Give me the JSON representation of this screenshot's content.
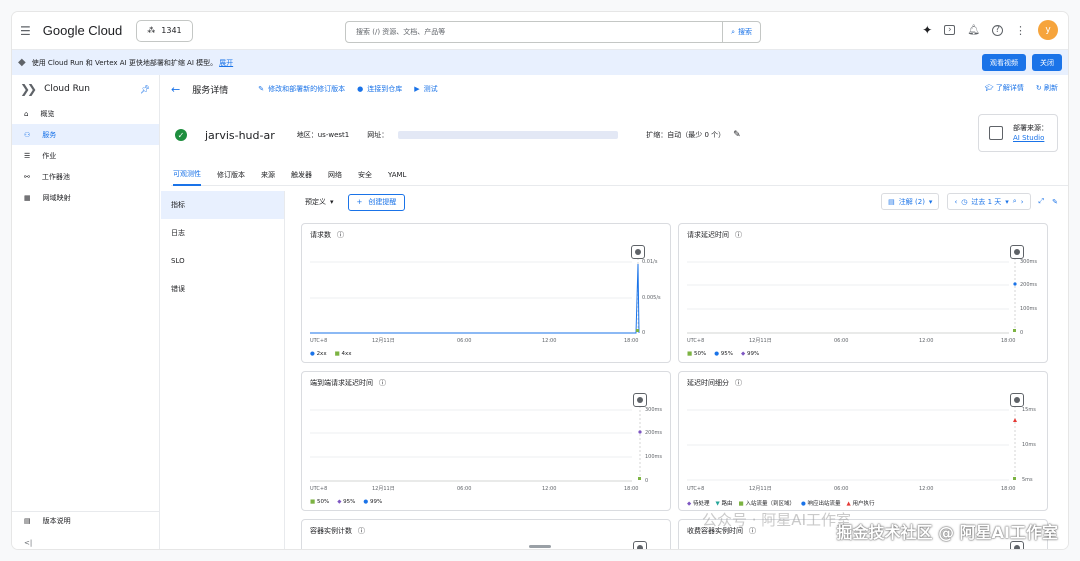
{
  "topbar": {
    "logo": "Google Cloud",
    "project": "1341",
    "search_placeholder": "搜索 (/) 资源、文档、产品等",
    "search_button": "搜索",
    "avatar": "y"
  },
  "banner": {
    "text": "使用 Cloud Run 和 Vertex AI 更快地部署和扩缩 AI 模型。",
    "link": "展开",
    "watch": "观看视频",
    "close": "关闭"
  },
  "sidebar": {
    "title": "Cloud Run",
    "items": [
      {
        "label": "概览"
      },
      {
        "label": "服务"
      },
      {
        "label": "作业"
      },
      {
        "label": "工作器池"
      },
      {
        "label": "网域映射"
      }
    ],
    "footer": "版本说明"
  },
  "header": {
    "title": "服务详情",
    "edit": "修改和部署新的修订版本",
    "connect": "连接到仓库",
    "test": "测试",
    "learn": "了解详情",
    "refresh": "刷新"
  },
  "service": {
    "name": "jarvis-hud-ar",
    "region_label": "地区：",
    "region": "us-west1",
    "url_label": "网址：",
    "scaling": "扩缩：自动（最少 0 个）",
    "deploy_label": "部署来源：",
    "deploy_link": "AI Studio"
  },
  "tabs": [
    "可观测性",
    "修订版本",
    "来源",
    "触发器",
    "网络",
    "安全",
    "YAML"
  ],
  "leftnav": [
    "指标",
    "日志",
    "SLO",
    "错误"
  ],
  "toolbar": {
    "predefined": "预定义",
    "create": "创建提醒",
    "annotations": "注解 (2)",
    "range": "过去 1 天"
  },
  "charts": [
    {
      "title": "请求数",
      "yticks": [
        "0.01/s",
        "0.005/s",
        "0"
      ],
      "xticks": [
        "UTC+8",
        "12月11日",
        "06:00",
        "12:00",
        "18:00"
      ],
      "legend": [
        {
          "label": "2xx",
          "color": "#1a73e8"
        },
        {
          "label": "4xx",
          "color": "#7cb342"
        }
      ]
    },
    {
      "title": "请求延迟时间",
      "yticks": [
        "300ms",
        "200ms",
        "100ms",
        "0"
      ],
      "xticks": [
        "UTC+8",
        "12月11日",
        "06:00",
        "12:00",
        "18:00"
      ],
      "legend": [
        {
          "label": "50%",
          "color": "#7cb342"
        },
        {
          "label": "95%",
          "color": "#1a73e8"
        },
        {
          "label": "99%",
          "color": "#7e57c2"
        }
      ]
    },
    {
      "title": "端到端请求延迟时间",
      "yticks": [
        "300ms",
        "200ms",
        "100ms",
        "0"
      ],
      "xticks": [
        "UTC+8",
        "12月11日",
        "06:00",
        "12:00",
        "18:00"
      ],
      "legend": [
        {
          "label": "50%",
          "color": "#7cb342"
        },
        {
          "label": "95%",
          "color": "#7e57c2"
        },
        {
          "label": "99%",
          "color": "#1a73e8"
        }
      ]
    },
    {
      "title": "延迟时间细分",
      "yticks": [
        "15ms",
        "10ms",
        "5ms"
      ],
      "xticks": [
        "UTC+8",
        "12月11日",
        "06:00",
        "12:00",
        "18:00"
      ],
      "legend": [
        {
          "label": "待处理",
          "color": "#7e57c2"
        },
        {
          "label": "路由",
          "color": "#26a69a"
        },
        {
          "label": "入站流量（到区域）",
          "color": "#7cb342"
        },
        {
          "label": "响应出站流量",
          "color": "#1a73e8"
        },
        {
          "label": "用户执行",
          "color": "#e53935"
        }
      ]
    },
    {
      "title": "容器实例计数"
    },
    {
      "title": "收费容器实例时间"
    }
  ],
  "watermark": "掘金技术社区 @ 阿星AI工作室",
  "watermark2": "公众号 · 阿星AI工作室"
}
